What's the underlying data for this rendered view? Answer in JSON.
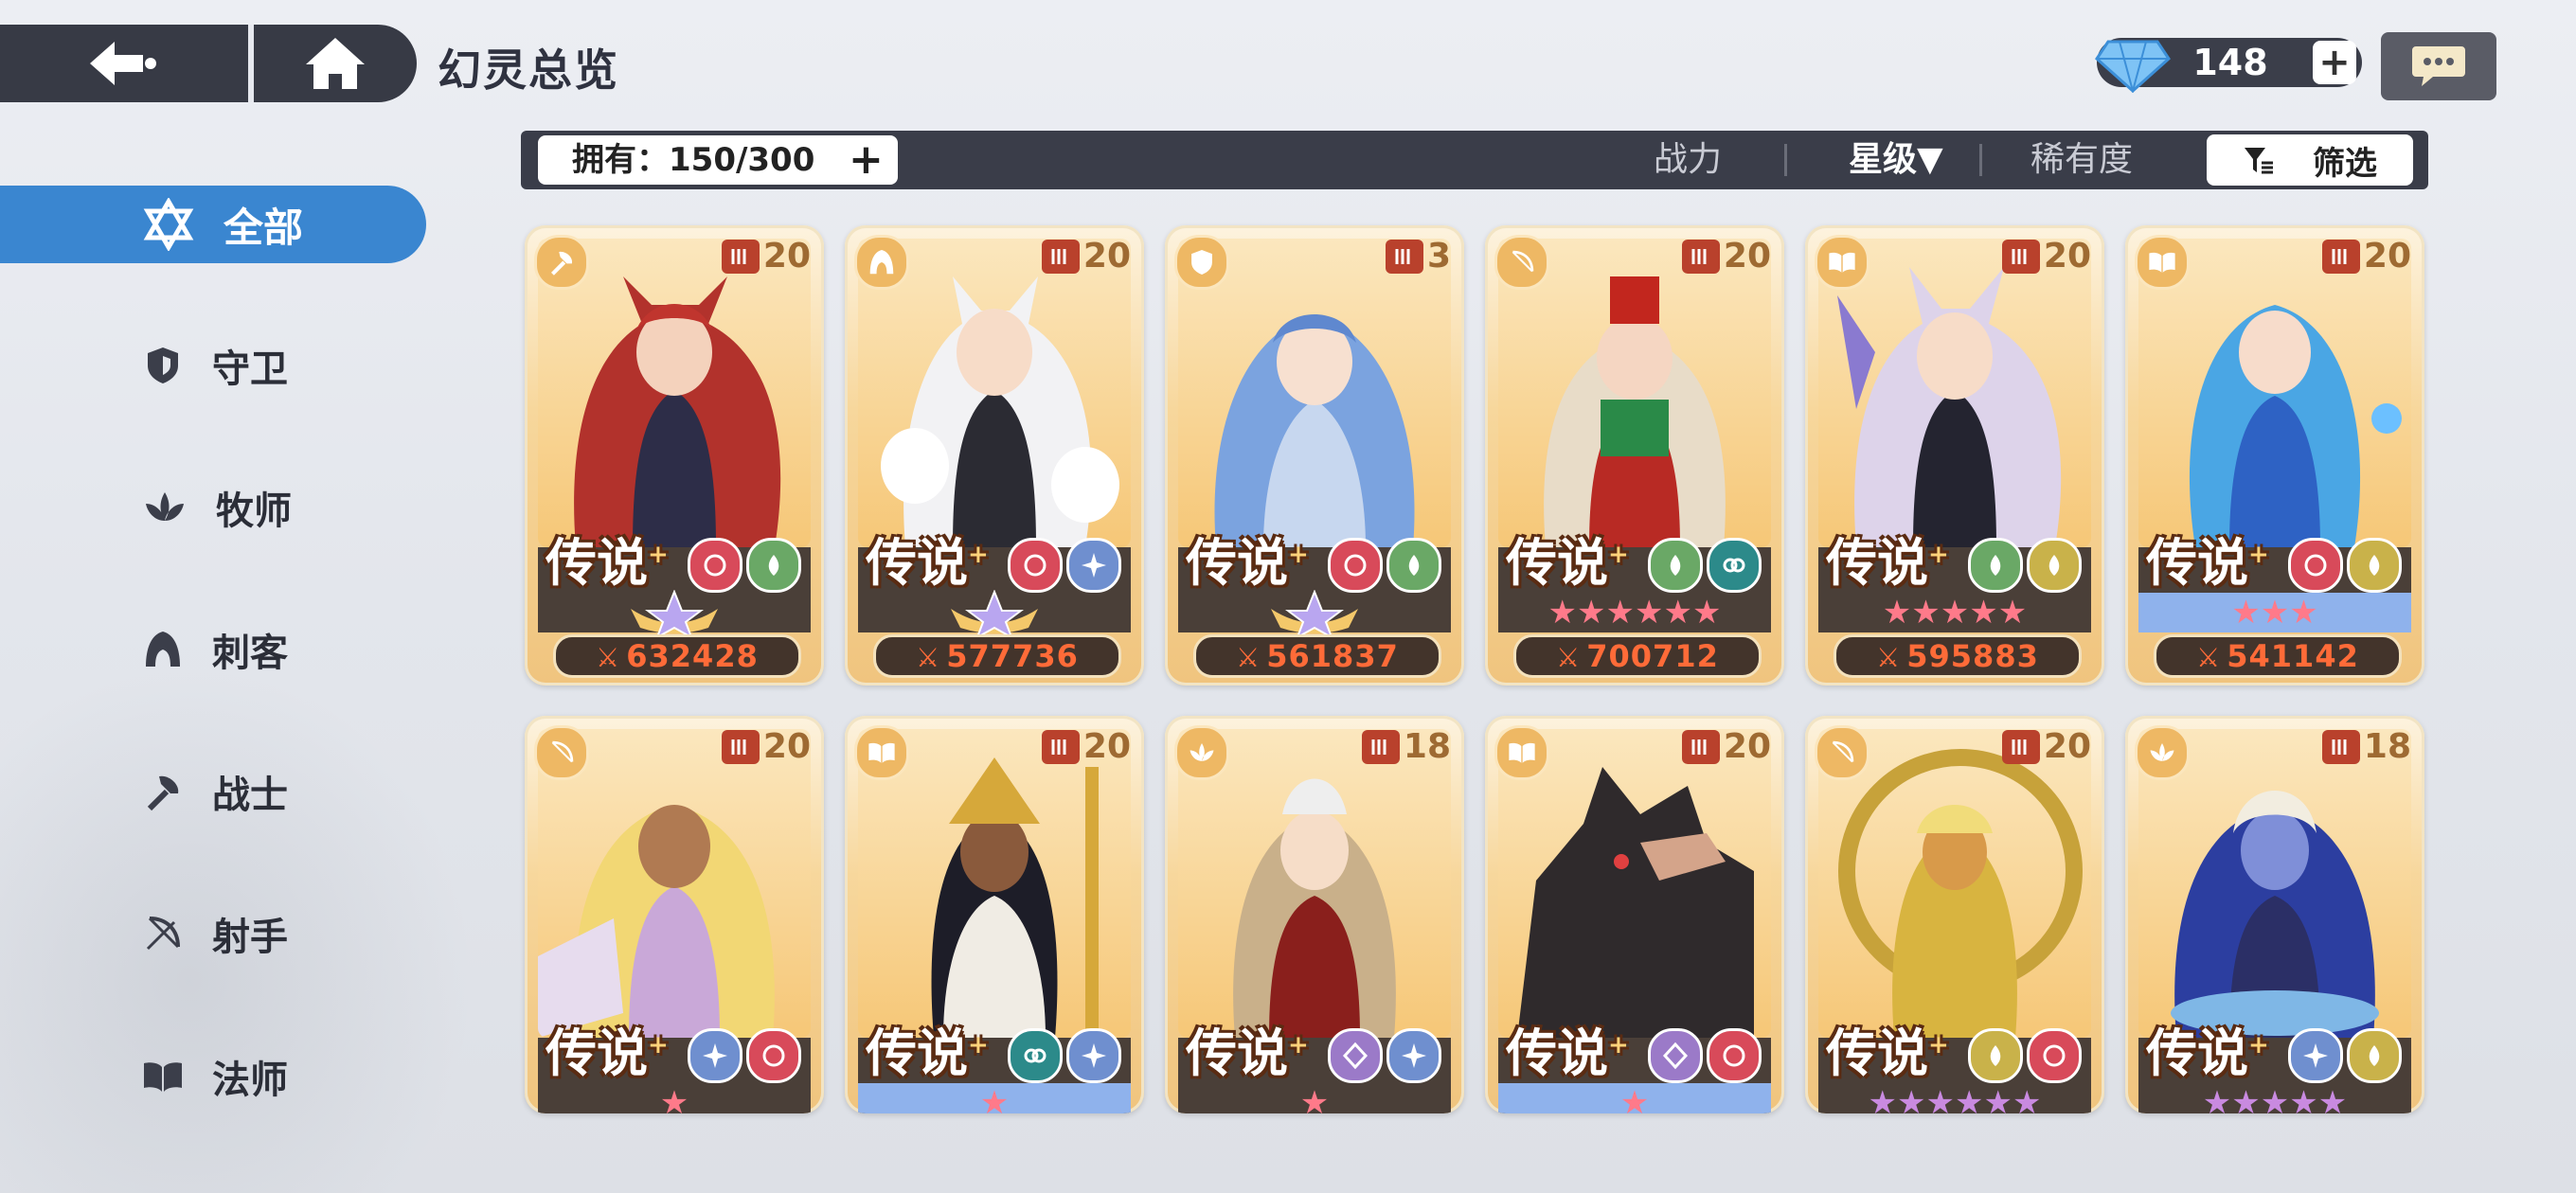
{
  "header": {
    "title": "幻灵总览"
  },
  "currency": {
    "gems": "148",
    "plus": "+"
  },
  "sidebar": {
    "items": [
      {
        "label": "全部",
        "icon": "star-of-david-icon"
      },
      {
        "label": "守卫",
        "icon": "shield-icon"
      },
      {
        "label": "牧师",
        "icon": "lotus-icon"
      },
      {
        "label": "刺客",
        "icon": "hood-icon"
      },
      {
        "label": "战士",
        "icon": "axe-icon"
      },
      {
        "label": "射手",
        "icon": "bow-icon"
      },
      {
        "label": "法师",
        "icon": "book-icon"
      }
    ]
  },
  "filterbar": {
    "owned": "拥有：150/300",
    "plus": "+",
    "sort_power": "战力",
    "sort_star": "星级▼",
    "sort_rarity": "稀有度",
    "filter": "筛选"
  },
  "cards": [
    {
      "level": "20",
      "rank": "传说",
      "power": "632428",
      "class": "axe-icon",
      "stars": "crown",
      "elements": [
        "#d84a5a",
        "#6aa866"
      ]
    },
    {
      "level": "20",
      "rank": "传说",
      "power": "577736",
      "class": "hood-icon",
      "stars": "crown",
      "elements": [
        "#d84a5a",
        "#6f8fcf"
      ]
    },
    {
      "level": "3",
      "rank": "传说",
      "power": "561837",
      "class": "shield-icon",
      "stars": "crown",
      "elements": [
        "#d84a5a",
        "#6aa866"
      ]
    },
    {
      "level": "20",
      "rank": "传说",
      "power": "700712",
      "class": "bow-icon",
      "stars": "★★★★★★",
      "elements": [
        "#6aa866",
        "#2c8a8a"
      ]
    },
    {
      "level": "20",
      "rank": "传说",
      "power": "595883",
      "class": "book-icon",
      "stars": "★★★★★",
      "elements": [
        "#6aa866",
        "#c9b24a"
      ]
    },
    {
      "level": "20",
      "rank": "传说",
      "power": "541142",
      "class": "book-icon",
      "stars": "★★★",
      "elements": [
        "#d84a5a",
        "#c9b24a"
      ]
    },
    {
      "level": "20",
      "rank": "传说",
      "class": "bow-icon",
      "stars": "★",
      "elements": [
        "#6f8fcf",
        "#d84a5a"
      ]
    },
    {
      "level": "20",
      "rank": "传说",
      "class": "book-icon",
      "stars": "★",
      "elements": [
        "#2c8a8a",
        "#6f8fcf"
      ]
    },
    {
      "level": "18",
      "rank": "传说",
      "class": "lotus-icon",
      "stars": "★",
      "elements": [
        "#9b7ac8",
        "#6f8fcf"
      ]
    },
    {
      "level": "20",
      "rank": "传说",
      "class": "book-icon",
      "stars": "★",
      "elements": [
        "#9b7ac8",
        "#d84a5a"
      ]
    },
    {
      "level": "20",
      "rank": "传说",
      "class": "bow-icon",
      "stars": "★★★★★★",
      "elements": [
        "#c9b24a",
        "#d84a5a"
      ]
    },
    {
      "level": "18",
      "rank": "传说",
      "class": "lotus-icon",
      "stars": "★★★★★",
      "elements": [
        "#6f8fcf",
        "#c9b24a"
      ]
    }
  ],
  "colors": {
    "accent": "#3a86d0",
    "bar": "#3a3d49",
    "power": "#ff6b38"
  }
}
